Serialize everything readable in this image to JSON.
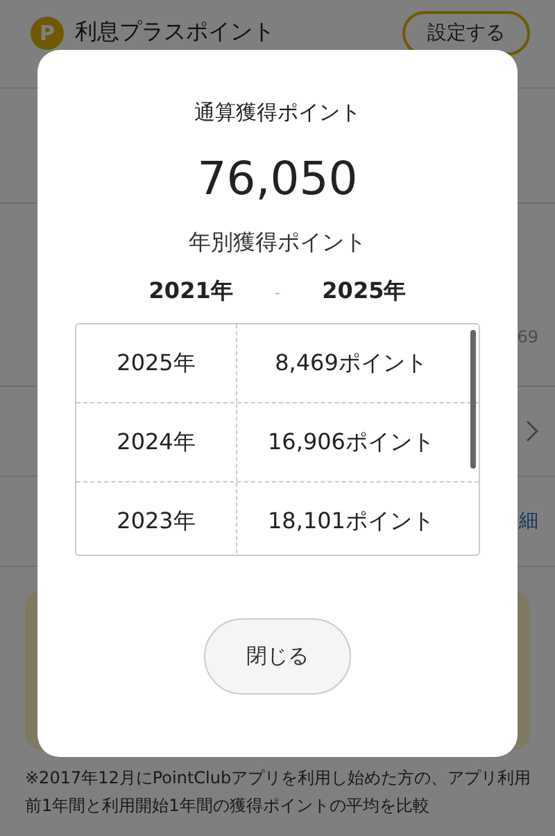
{
  "background": {
    "header": {
      "icon_letter": "P",
      "title": "利息プラスポイント",
      "button": "設定する"
    },
    "partial_value": "69",
    "rows": [
      {
        "kind": "chevron"
      },
      {
        "kind": "link",
        "link": "細"
      }
    ],
    "footnote": "※2017年12月にPointClubアプリを利用し始めた方の、アプリ利用前1年間と利用開始1年間の獲得ポイントの平均を比較"
  },
  "modal": {
    "title": "通算獲得ポイント",
    "total": "76,050",
    "subtitle": "年別獲得ポイント",
    "range": {
      "from": "2021年",
      "separator": "-",
      "to": "2025年"
    },
    "table": {
      "rows": [
        {
          "year": "2025年",
          "points": "8,469ポイント"
        },
        {
          "year": "2024年",
          "points": "16,906ポイント"
        },
        {
          "year": "2023年",
          "points": "18,101ポイント"
        }
      ]
    },
    "close_button": "閉じる"
  }
}
